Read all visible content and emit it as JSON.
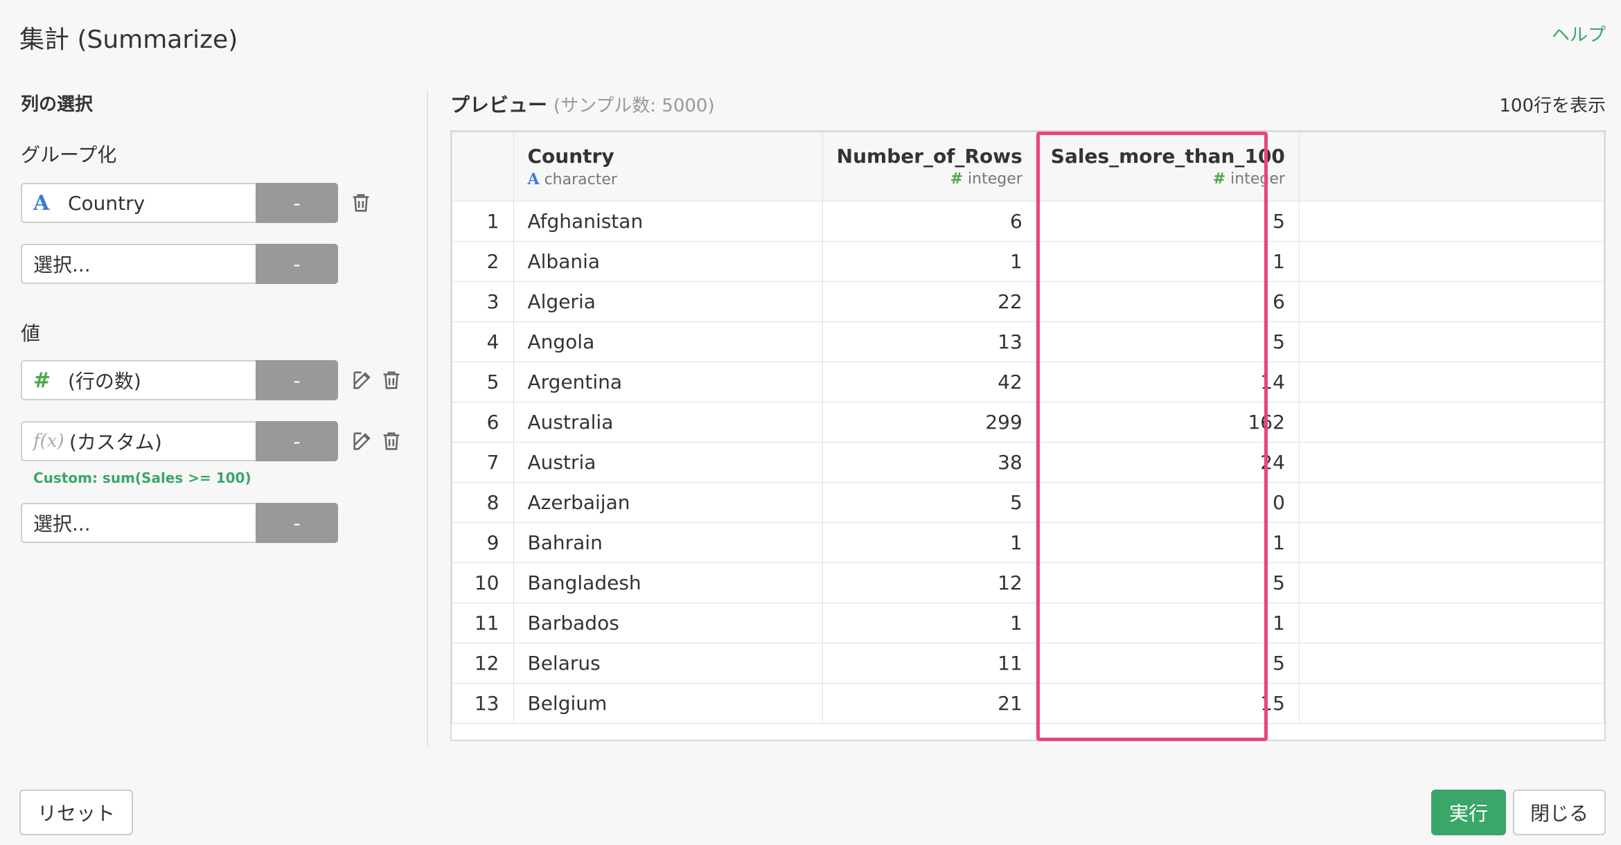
{
  "header": {
    "title": "集計 (Summarize)",
    "help_label": "ヘルプ"
  },
  "left": {
    "section_title": "列の選択",
    "group_title": "グループ化",
    "group_items": [
      {
        "type_icon": "A",
        "label": "Country",
        "button": "-"
      },
      {
        "label": "選択...",
        "button": "-"
      }
    ],
    "value_title": "値",
    "value_items": [
      {
        "type_icon": "#",
        "label": "(行の数)",
        "button": "-"
      },
      {
        "type_icon": "f(x)",
        "label": "(カスタム)",
        "button": "-"
      },
      {
        "label": "選択...",
        "button": "-"
      }
    ],
    "custom_note": "Custom: sum(Sales >= 100)"
  },
  "preview": {
    "title": "プレビュー",
    "sample": "(サンプル数: 5000)",
    "rows_label": "100行を表示",
    "columns": [
      {
        "name": "Country",
        "type": "character",
        "type_icon": "A"
      },
      {
        "name": "Number_of_Rows",
        "type": "integer",
        "type_icon": "#"
      },
      {
        "name": "Sales_more_than_100",
        "type": "integer",
        "type_icon": "#"
      }
    ],
    "rows": [
      [
        "1",
        "Afghanistan",
        "6",
        "5"
      ],
      [
        "2",
        "Albania",
        "1",
        "1"
      ],
      [
        "3",
        "Algeria",
        "22",
        "6"
      ],
      [
        "4",
        "Angola",
        "13",
        "5"
      ],
      [
        "5",
        "Argentina",
        "42",
        "14"
      ],
      [
        "6",
        "Australia",
        "299",
        "162"
      ],
      [
        "7",
        "Austria",
        "38",
        "24"
      ],
      [
        "8",
        "Azerbaijan",
        "5",
        "0"
      ],
      [
        "9",
        "Bahrain",
        "1",
        "1"
      ],
      [
        "10",
        "Bangladesh",
        "12",
        "5"
      ],
      [
        "11",
        "Barbados",
        "1",
        "1"
      ],
      [
        "12",
        "Belarus",
        "11",
        "5"
      ],
      [
        "13",
        "Belgium",
        "21",
        "15"
      ]
    ],
    "highlight_color": "#e8457a"
  },
  "footer": {
    "reset_label": "リセット",
    "run_label": "実行",
    "close_label": "閉じる"
  },
  "colors": {
    "accent": "#3aa66a",
    "char_type": "#3a7bd5",
    "int_type": "#4ca64c"
  }
}
